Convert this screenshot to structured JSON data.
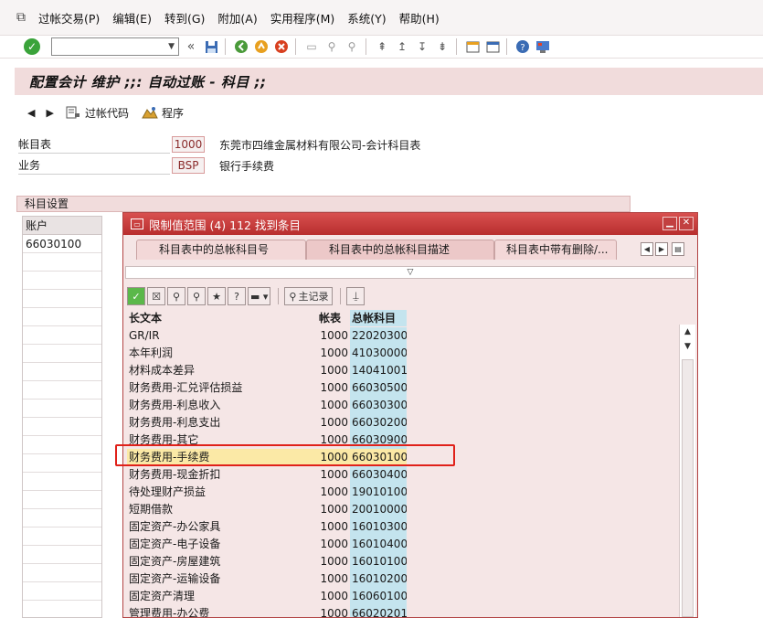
{
  "menu": [
    "过帐交易(P)",
    "编辑(E)",
    "转到(G)",
    "附加(A)",
    "实用程序(M)",
    "系统(Y)",
    "帮助(H)"
  ],
  "toolbar": {
    "command_value": "",
    "dropdown_icon": "▼",
    "collapse_icon": "«"
  },
  "page_title": "配置会计 维护 ;;: 自动过账 - 科目 ;;",
  "app_toolbar": {
    "posting_key": "过帐代码",
    "procedure": "程序"
  },
  "fields": {
    "coa_label": "帐目表",
    "coa_value": "1000",
    "coa_desc": "东莞市四维金属材料有限公司-会计科目表",
    "trans_label": "业务",
    "trans_value": "BSP",
    "trans_desc": "银行手续费"
  },
  "group_title": "科目设置",
  "account_table": {
    "header": "账户",
    "rows": [
      "66030100"
    ]
  },
  "dialog": {
    "title": "限制值范围 (4)   112 找到条目",
    "tabs": [
      "科目表中的总帐科目号",
      "科目表中的总帐科目描述",
      "科目表中带有删除/..."
    ],
    "active_tab": 1,
    "main_record_label": "主记录",
    "columns": [
      "长文本",
      "帐表",
      "总帐科目"
    ],
    "selected_row": 7,
    "rows": [
      {
        "text": "GR/IR",
        "coa": "1000",
        "acct": "22020300"
      },
      {
        "text": "本年利润",
        "coa": "1000",
        "acct": "41030000"
      },
      {
        "text": "材料成本差异",
        "coa": "1000",
        "acct": "14041001"
      },
      {
        "text": "财务费用-汇兑评估损益",
        "coa": "1000",
        "acct": "66030500"
      },
      {
        "text": "财务费用-利息收入",
        "coa": "1000",
        "acct": "66030300"
      },
      {
        "text": "财务费用-利息支出",
        "coa": "1000",
        "acct": "66030200"
      },
      {
        "text": "财务费用-其它",
        "coa": "1000",
        "acct": "66030900"
      },
      {
        "text": "财务费用-手续费",
        "coa": "1000",
        "acct": "66030100"
      },
      {
        "text": "财务费用-现金折扣",
        "coa": "1000",
        "acct": "66030400"
      },
      {
        "text": "待处理财产损益",
        "coa": "1000",
        "acct": "19010100"
      },
      {
        "text": "短期借款",
        "coa": "1000",
        "acct": "20010000"
      },
      {
        "text": "固定资产-办公家具",
        "coa": "1000",
        "acct": "16010300"
      },
      {
        "text": "固定资产-电子设备",
        "coa": "1000",
        "acct": "16010400"
      },
      {
        "text": "固定资产-房屋建筑",
        "coa": "1000",
        "acct": "16010100"
      },
      {
        "text": "固定资产-运输设备",
        "coa": "1000",
        "acct": "16010200"
      },
      {
        "text": "固定资产清理",
        "coa": "1000",
        "acct": "16060100"
      },
      {
        "text": "管理费用-办公费",
        "coa": "1000",
        "acct": "66020201"
      }
    ]
  },
  "colors": {
    "title_bg": "#f1dcdc",
    "dialog_title": "#c03a3a",
    "acct_col": "#c4e4ee",
    "selection": "#fbe9a6",
    "highlight_box": "#e0211a"
  }
}
